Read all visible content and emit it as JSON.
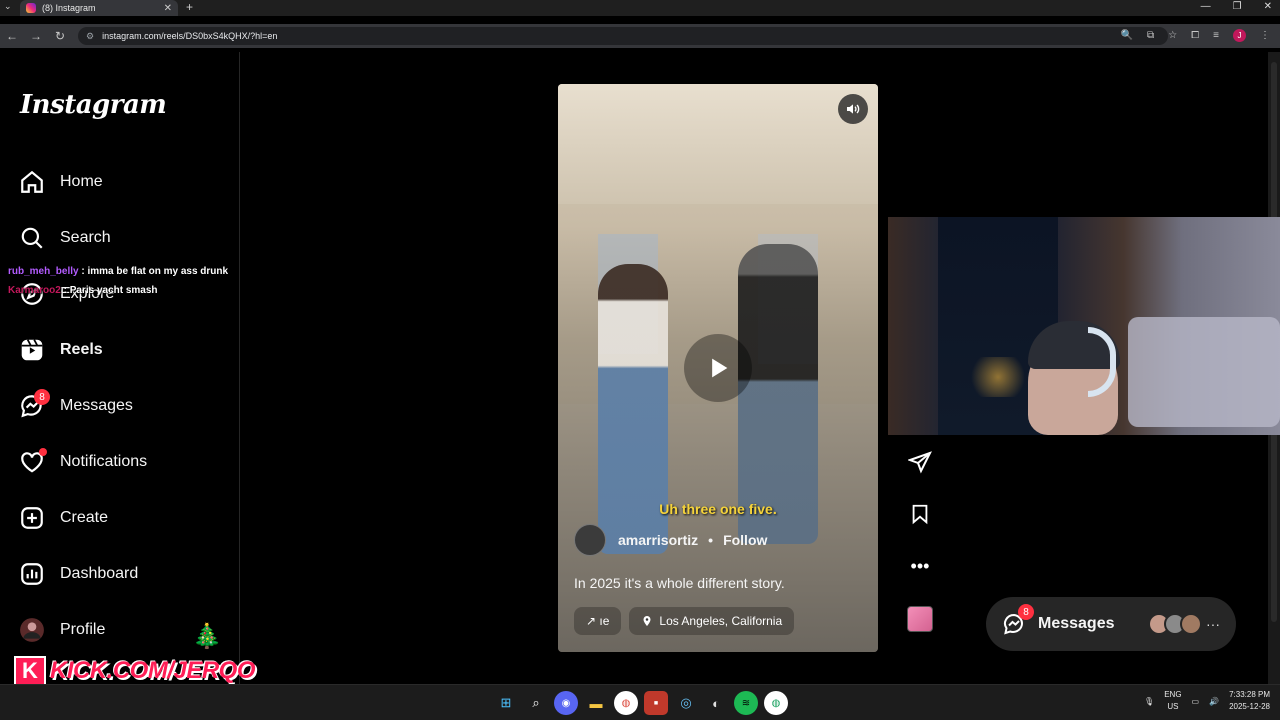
{
  "browser": {
    "tab_title": "(8) Instagram",
    "url": "instagram.com/reels/DS0bxS4kQHX/?hl=en",
    "profile_initial": "J"
  },
  "sidebar": {
    "logo": "Instagram",
    "items": [
      {
        "label": "Home",
        "icon": "home-icon"
      },
      {
        "label": "Search",
        "icon": "search-icon"
      },
      {
        "label": "Explore",
        "icon": "compass-icon"
      },
      {
        "label": "Reels",
        "icon": "reels-icon"
      },
      {
        "label": "Messages",
        "icon": "messenger-icon",
        "badge": "8"
      },
      {
        "label": "Notifications",
        "icon": "heart-icon"
      },
      {
        "label": "Create",
        "icon": "plus-square-icon"
      },
      {
        "label": "Dashboard",
        "icon": "dashboard-icon"
      },
      {
        "label": "Profile",
        "icon": "avatar"
      }
    ]
  },
  "chat": [
    {
      "user": "rub_meh_belly",
      "message": ": imma be flat on my ass drunk"
    },
    {
      "user": "Karmaroo2",
      "message": ": Paris yacht smash"
    }
  ],
  "kick_banner": "KICK.COM/JERQO",
  "reel": {
    "caption_overlay": "Uh three one five.",
    "author": "amarrisortiz",
    "follow": "Follow",
    "separator": "•",
    "description": "In 2025 it's a whole different story.",
    "audio_pill": "↗ ıe",
    "location": "Los Angeles, California"
  },
  "messages_pill": {
    "label": "Messages",
    "badge": "8",
    "more": "···"
  },
  "taskbar": {
    "lang_line1": "ENG",
    "lang_line2": "US",
    "time": "7:33:28 PM",
    "date": "2025-12-28"
  }
}
